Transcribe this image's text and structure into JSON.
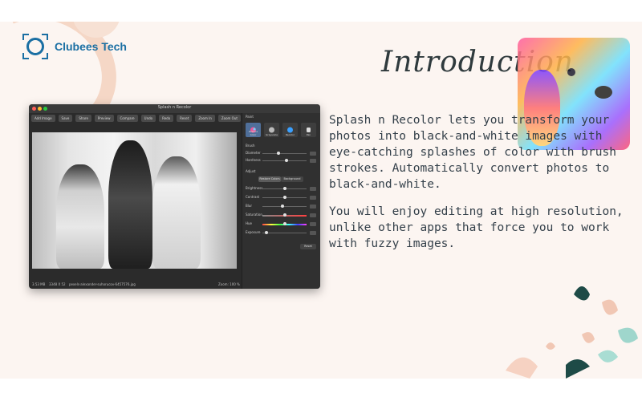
{
  "brand": {
    "name": "Clubees Tech",
    "color": "#1a6fa3"
  },
  "heading": "Introduction",
  "paragraphs": [
    "Splash n Recolor lets you transform your photos into black-and-white images with eye-catching splashes of color with brush strokes. Automatically convert photos to black-and-white.",
    "You will enjoy editing at high resolution, unlike other apps that force you to work with fuzzy images."
  ],
  "app": {
    "window_title": "Splash n Recolor",
    "toolbar": [
      "Add Image",
      "Save",
      "Share",
      "Preview",
      "Compare",
      "Undo",
      "Redo",
      "Reset",
      "Zoom In",
      "Zoom Out",
      "Fit Screen"
    ],
    "status": {
      "left": "3.53 MB",
      "dims": "3348 X 52",
      "filename": "pexels-alexander-suhorucov-6457576.jpg",
      "zoom": "Zoom: 100 %"
    },
    "panel": {
      "paint_label": "Paint",
      "tools": [
        "Restore Color",
        "Grayscale",
        "Recolor",
        "Pan"
      ],
      "brush_label": "Brush",
      "brush_sliders": [
        {
          "label": "Diameter",
          "value": 0.35
        },
        {
          "label": "Hardness",
          "value": 0.55
        }
      ],
      "adjust_label": "Adjust",
      "adjust_tabs": [
        "Restore Colors",
        "Background"
      ],
      "adjust_sliders": [
        {
          "label": "Brightness",
          "value": 0.5
        },
        {
          "label": "Contrast",
          "value": 0.5
        },
        {
          "label": "Blur",
          "value": 0.45
        },
        {
          "label": "Saturation",
          "value": 0.5
        },
        {
          "label": "Hue",
          "value": 0.5
        },
        {
          "label": "Exposure",
          "value": 0.05
        }
      ],
      "reset_label": "Reset"
    }
  }
}
